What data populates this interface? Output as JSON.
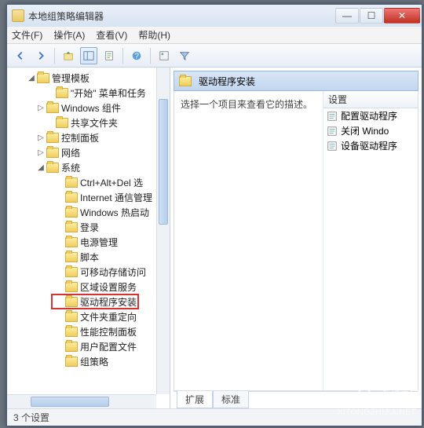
{
  "window": {
    "title": "本地组策略编辑器",
    "close_label": "✕",
    "max_label": "☐",
    "min_label": "—"
  },
  "menu": {
    "file": "文件(F)",
    "action": "操作(A)",
    "view": "查看(V)",
    "help": "帮助(H)"
  },
  "tree": {
    "items": [
      {
        "indent": 2,
        "exp": "◢",
        "label": "管理模板"
      },
      {
        "indent": 4,
        "exp": "",
        "label": "\"开始\" 菜单和任务"
      },
      {
        "indent": 3,
        "exp": "▷",
        "label": "Windows 组件"
      },
      {
        "indent": 4,
        "exp": "",
        "label": "共享文件夹"
      },
      {
        "indent": 3,
        "exp": "▷",
        "label": "控制面板"
      },
      {
        "indent": 3,
        "exp": "▷",
        "label": "网络"
      },
      {
        "indent": 3,
        "exp": "◢",
        "label": "系统"
      },
      {
        "indent": 5,
        "exp": "",
        "label": "Ctrl+Alt+Del 选"
      },
      {
        "indent": 5,
        "exp": "",
        "label": "Internet 通信管理"
      },
      {
        "indent": 5,
        "exp": "",
        "label": "Windows 热启动"
      },
      {
        "indent": 5,
        "exp": "",
        "label": "登录"
      },
      {
        "indent": 5,
        "exp": "",
        "label": "电源管理"
      },
      {
        "indent": 5,
        "exp": "",
        "label": "脚本"
      },
      {
        "indent": 5,
        "exp": "",
        "label": "可移动存储访问"
      },
      {
        "indent": 5,
        "exp": "",
        "label": "区域设置服务"
      },
      {
        "indent": 5,
        "exp": "",
        "label": "驱动程序安装",
        "highlighted": true
      },
      {
        "indent": 5,
        "exp": "",
        "label": "文件夹重定向"
      },
      {
        "indent": 5,
        "exp": "",
        "label": "性能控制面板"
      },
      {
        "indent": 5,
        "exp": "",
        "label": "用户配置文件"
      },
      {
        "indent": 5,
        "exp": "",
        "label": "组策略"
      }
    ]
  },
  "detail": {
    "header_title": "驱动程序安装",
    "description_prompt": "选择一个项目来查看它的描述。",
    "columns": {
      "setting": "设置"
    },
    "items": [
      {
        "label": "配置驱动程序"
      },
      {
        "label": "关闭 Windo"
      },
      {
        "label": "设备驱动程序"
      }
    ]
  },
  "tabs": {
    "extended": "扩展",
    "standard": "标准"
  },
  "status": {
    "text": "3 个设置"
  },
  "watermark": {
    "text": "系统之家",
    "url": "XITONGZHIJIA.NET"
  }
}
